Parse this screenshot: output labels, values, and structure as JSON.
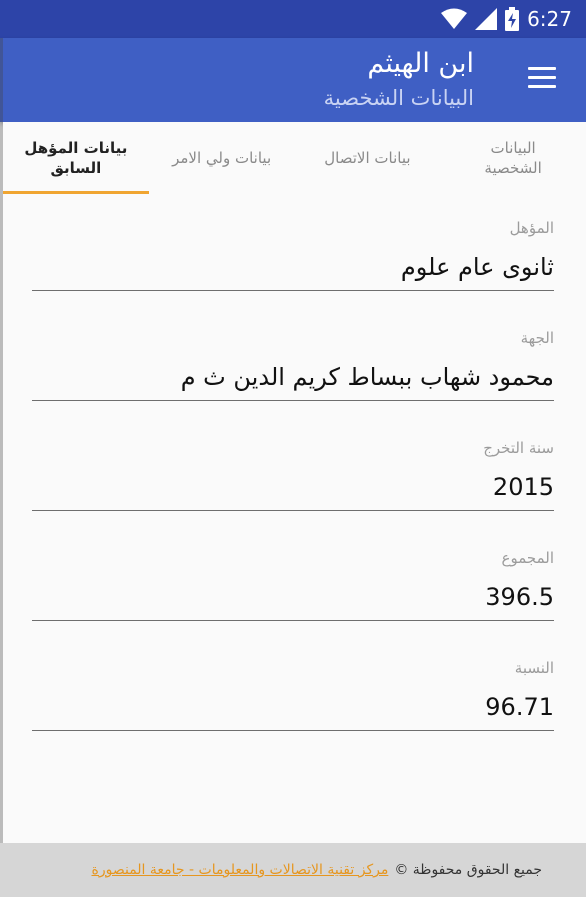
{
  "status_bar": {
    "time": "6:27",
    "icons": [
      "wifi-icon",
      "signal-icon",
      "battery-charging-icon"
    ]
  },
  "app_bar": {
    "title": "ابن الهيثم",
    "subtitle": "البيانات الشخصية",
    "menu_icon": "hamburger-menu-icon"
  },
  "tabs": [
    {
      "label": "البيانات الشخصية",
      "active": false
    },
    {
      "label": "بيانات الاتصال",
      "active": false
    },
    {
      "label": "بيانات ولي الامر",
      "active": false
    },
    {
      "label": "بيانات المؤهل السابق",
      "active": true
    }
  ],
  "fields": [
    {
      "label": "المؤهل",
      "value": "ثانوى عام علوم"
    },
    {
      "label": "الجهة",
      "value": "محمود شهاب ببساط كريم الدين ث م"
    },
    {
      "label": "سنة التخرج",
      "value": "2015"
    },
    {
      "label": "المجموع",
      "value": "396.5"
    },
    {
      "label": "النسبة",
      "value": "96.71"
    }
  ],
  "footer": {
    "rights_text": "جميع الحقوق محفوظة ©",
    "link_text": "مركز تقنية الاتصالات والمعلومات - جامعة المنصورة"
  },
  "colors": {
    "status_bar": "#2d44a8",
    "app_bar": "#3f5fc4",
    "tab_indicator": "#f0a531",
    "footer_link": "#e6961f"
  }
}
